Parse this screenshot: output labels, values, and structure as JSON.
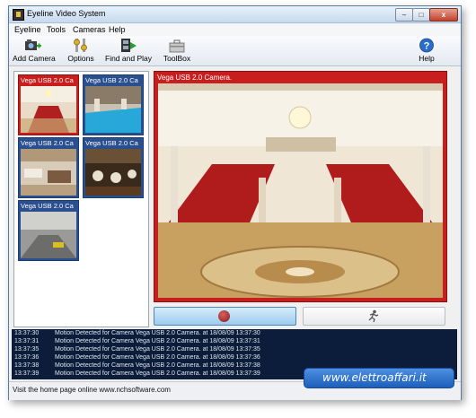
{
  "window": {
    "title": "Eyeline Video System",
    "controls": {
      "minimize": "–",
      "maximize": "□",
      "close": "x"
    }
  },
  "menu": [
    "Eyeline",
    "Tools",
    "Cameras",
    "Help"
  ],
  "toolbar": {
    "add_camera": "Add Camera",
    "options": "Options",
    "find_and_play": "Find and Play",
    "toolbox": "ToolBox",
    "help": "Help"
  },
  "cameras": [
    {
      "label": "Vega USB 2.0 Ca",
      "selected": true
    },
    {
      "label": "Vega USB 2.0 Ca",
      "selected": false
    },
    {
      "label": "Vega USB 2.0 Ca",
      "selected": false
    },
    {
      "label": "Vega USB 2.0 Ca",
      "selected": false
    },
    {
      "label": "Vega USB 2.0 Ca",
      "selected": false
    }
  ],
  "main_view": {
    "label": "Vega USB 2.0 Camera."
  },
  "log": [
    {
      "time": "13:37:30",
      "msg": "Motion Detected for Camera Vega USB 2.0 Camera. at 18/08/09 13:37:30"
    },
    {
      "time": "13:37:31",
      "msg": "Motion Detected for Camera Vega USB 2.0 Camera. at 18/08/09 13:37:31"
    },
    {
      "time": "13:37:35",
      "msg": "Motion Detected for Camera Vega USB 2.0 Camera. at 18/08/09 13:37:35"
    },
    {
      "time": "13:37:36",
      "msg": "Motion Detected for Camera Vega USB 2.0 Camera. at 18/08/09 13:37:36"
    },
    {
      "time": "13:37:38",
      "msg": "Motion Detected for Camera Vega USB 2.0 Camera. at 18/08/09 13:37:38"
    },
    {
      "time": "13:37:39",
      "msg": "Motion Detected for Camera Vega USB 2.0 Camera. at 18/08/09 13:37:39"
    }
  ],
  "status": "Visit the home page online www.nchsoftware.com",
  "watermark": "www.elettroaffari.it",
  "colors": {
    "selected_camera": "#c81e1e",
    "camera_tile": "#2a4f8e",
    "log_bg": "#0b1d3a"
  }
}
